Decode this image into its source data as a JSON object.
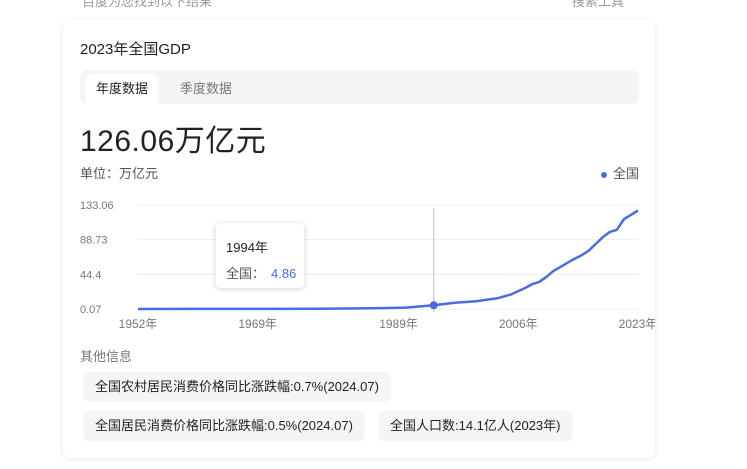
{
  "page": {
    "top_hint": "百度为您找到以下结果",
    "top_tools": "搜索工具"
  },
  "card": {
    "title": "2023年全国GDP",
    "tabs": [
      {
        "label": "年度数据",
        "active": true
      },
      {
        "label": "季度数据",
        "active": false
      }
    ],
    "big_value": "126.06万亿元",
    "unit_label": "单位：万亿元",
    "legend_label": "全国",
    "tooltip": {
      "year": "1994年",
      "label": "全国：",
      "value": "4.86"
    },
    "other_info_title": "其他信息",
    "chips": [
      "全国农村居民消费价格同比涨跌幅:0.7%(2024.07)",
      "全国居民消费价格同比涨跌幅:0.5%(2024.07)",
      "全国人口数:14.1亿人(2023年)"
    ]
  },
  "colors": {
    "accent": "#4b6bde",
    "grid": "#eeeeee",
    "axis_text": "#777777"
  },
  "chart_data": {
    "type": "line",
    "series": [
      {
        "name": "全国"
      }
    ],
    "y_ticks": [
      "133.06",
      "88.73",
      "44.4",
      "0.07"
    ],
    "x_ticks": [
      "1952年",
      "1969年",
      "1989年",
      "2006年",
      "2023年"
    ],
    "ylim": [
      0.07,
      133.06
    ],
    "xlim": [
      1952,
      2023
    ],
    "highlight": {
      "x": 1994,
      "y": 4.86
    },
    "x": [
      1952,
      1960,
      1970,
      1978,
      1985,
      1990,
      1994,
      1997,
      2000,
      2003,
      2005,
      2007,
      2008,
      2009,
      2010,
      2011,
      2012,
      2013,
      2014,
      2015,
      2016,
      2017,
      2018,
      2019,
      2020,
      2021,
      2022,
      2023
    ],
    "values": [
      0.07,
      0.15,
      0.23,
      0.37,
      0.91,
      1.89,
      4.86,
      7.97,
      10.03,
      13.74,
      18.73,
      27.01,
      31.92,
      34.85,
      41.21,
      48.79,
      53.86,
      59.3,
      64.36,
      68.89,
      74.64,
      83.2,
      91.93,
      98.65,
      101.36,
      114.92,
      120.47,
      126.06
    ]
  }
}
